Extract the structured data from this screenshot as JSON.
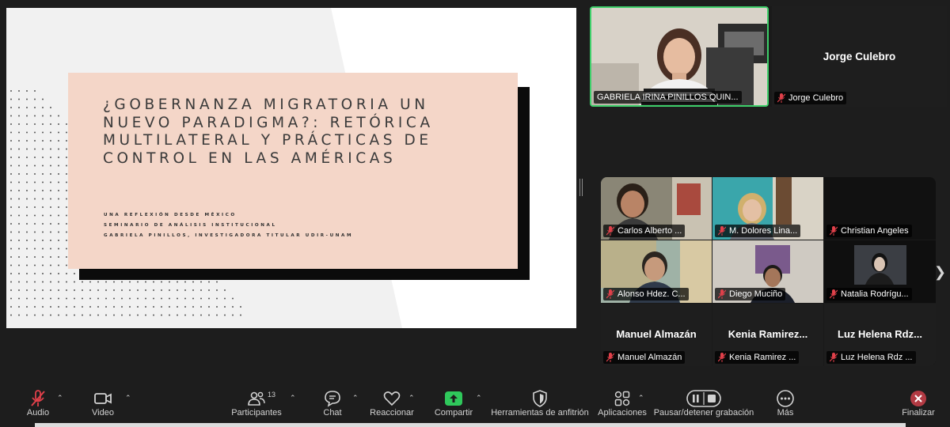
{
  "slide": {
    "title": "¿Gobernanza migratoria un nuevo paradigma?: Retórica multilateral y prácticas de control en las Américas",
    "subtitles": [
      "Una reflexión desde México",
      "Seminario de Análisis Institucional",
      "Gabriela Pinillos, Investigadora titular UDIR-UNAM"
    ],
    "colors": {
      "background": "#f1f1f1",
      "card": "#f4d6c8",
      "accent": "#e56d5f"
    }
  },
  "top_participants": [
    {
      "name": "GABRIELA IRINA PINILLOS QUIN...",
      "active_speaker": true
    },
    {
      "display_name": "Jorge Culebro",
      "name": "Jorge Culebro"
    }
  ],
  "gallery": [
    {
      "name": "Carlos Alberto ..."
    },
    {
      "name": "M. Dolores Lina..."
    },
    {
      "name": "Christian Angeles"
    },
    {
      "name": "Alonso Hdez. C..."
    },
    {
      "name": "Diego Muciño"
    },
    {
      "name": "Natalia Rodrígu..."
    },
    {
      "display_name": "Manuel Almazán",
      "name": "Manuel Almazán"
    },
    {
      "display_name": "Kenia Ramirez...",
      "name": "Kenia Ramirez ..."
    },
    {
      "display_name": "Luz Helena Rdz...",
      "name": "Luz Helena Rdz ..."
    }
  ],
  "toolbar": {
    "audio": "Audio",
    "video": "Video",
    "participants": "Participantes",
    "participants_count": "13",
    "chat": "Chat",
    "react": "Reaccionar",
    "share": "Compartir",
    "host_tools": "Herramientas de anfitrión",
    "apps": "Aplicaciones",
    "record": "Pausar/detener grabación",
    "more": "Más",
    "end": "Finalizar"
  },
  "icons": [
    "microphone-muted-icon",
    "video-camera-icon",
    "participants-icon",
    "chat-icon",
    "heart-icon",
    "share-arrow-icon",
    "shield-icon",
    "apps-icon",
    "pause-stop-icon",
    "more-dots-icon",
    "close-x-icon"
  ],
  "theme": {
    "active_speaker_border": "#3ecf6a",
    "share_green": "#2fc85b",
    "muted_red": "#e0404a",
    "end_red": "#b23a43"
  }
}
